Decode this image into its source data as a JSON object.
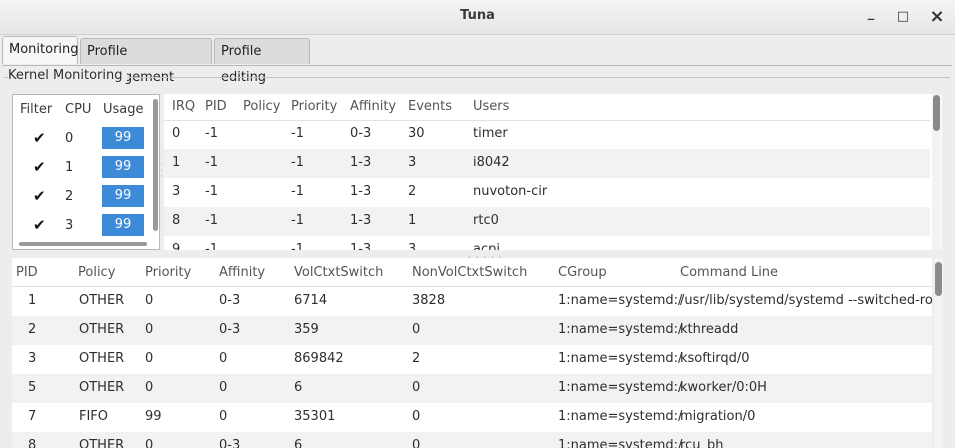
{
  "window": {
    "title": "Tuna",
    "minimize": "_",
    "maximize": "□",
    "close": "×"
  },
  "tabs": [
    {
      "label": "Monitoring",
      "active": true
    },
    {
      "label": "Profile management",
      "active": false
    },
    {
      "label": "Profile editing",
      "active": false
    }
  ],
  "frame_label": "Kernel Monitoring",
  "cpu_table": {
    "headers": [
      "Filter",
      "CPU",
      "Usage"
    ],
    "rows": [
      {
        "checked": true,
        "cpu": "0",
        "usage": "99"
      },
      {
        "checked": true,
        "cpu": "1",
        "usage": "99"
      },
      {
        "checked": true,
        "cpu": "2",
        "usage": "99"
      },
      {
        "checked": true,
        "cpu": "3",
        "usage": "99"
      }
    ],
    "check_glyph": "✔"
  },
  "irq_table": {
    "headers": [
      "IRQ",
      "PID",
      "Policy",
      "Priority",
      "Affinity",
      "Events",
      "Users"
    ],
    "rows": [
      [
        "0",
        "-1",
        "",
        "-1",
        "0-3",
        "30",
        "timer"
      ],
      [
        "1",
        "-1",
        "",
        "-1",
        "1-3",
        "3",
        "i8042"
      ],
      [
        "3",
        "-1",
        "",
        "-1",
        "1-3",
        "2",
        "nuvoton-cir"
      ],
      [
        "8",
        "-1",
        "",
        "-1",
        "1-3",
        "1",
        "rtc0"
      ],
      [
        "9",
        "-1",
        "",
        "-1",
        "1-3",
        "3",
        "acpi"
      ]
    ]
  },
  "proc_table": {
    "headers": [
      "PID",
      "Policy",
      "Priority",
      "Affinity",
      "VolCtxtSwitch",
      "NonVolCtxtSwitch",
      "CGroup",
      "Command Line"
    ],
    "rows": [
      [
        "1",
        "OTHER",
        "0",
        "0-3",
        "6714",
        "3828",
        "1:name=systemd:/",
        "/usr/lib/systemd/systemd --switched-root"
      ],
      [
        "2",
        "OTHER",
        "0",
        "0-3",
        "359",
        "0",
        "1:name=systemd:/",
        "kthreadd"
      ],
      [
        "3",
        "OTHER",
        "0",
        "0",
        "869842",
        "2",
        "1:name=systemd:/",
        "ksoftirqd/0"
      ],
      [
        "5",
        "OTHER",
        "0",
        "0",
        "6",
        "0",
        "1:name=systemd:/",
        "kworker/0:0H"
      ],
      [
        "7",
        "FIFO",
        "99",
        "0",
        "35301",
        "0",
        "1:name=systemd:/",
        "migration/0"
      ],
      [
        "8",
        "OTHER",
        "0",
        "0-3",
        "6",
        "0",
        "1:name=systemd:/",
        "rcu_bh"
      ]
    ]
  },
  "colors": {
    "usage_bar": "#3d8bd8",
    "row_alt": "#f2f2f2"
  }
}
